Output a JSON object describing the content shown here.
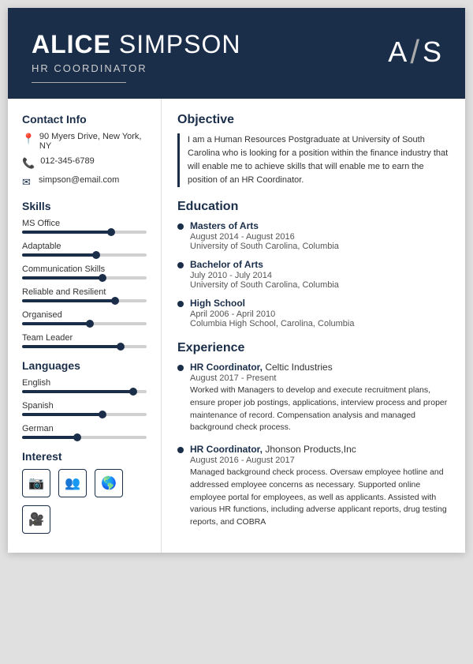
{
  "header": {
    "first_name": "ALICE",
    "last_name": "SIMPSON",
    "title": "HR COORDINATOR",
    "initial_first": "A",
    "slash": "/",
    "initial_last": "S"
  },
  "contact": {
    "section_title": "Contact Info",
    "address": "90 Myers Drive, New York, NY",
    "phone": "012-345-6789",
    "email": "simpson@email.com"
  },
  "skills": {
    "section_title": "Skills",
    "items": [
      {
        "name": "MS Office",
        "percent": 72
      },
      {
        "name": "Adaptable",
        "percent": 60
      },
      {
        "name": "Communication Skills",
        "percent": 65
      },
      {
        "name": "Reliable and Resilient",
        "percent": 75
      },
      {
        "name": "Organised",
        "percent": 55
      },
      {
        "name": "Team Leader",
        "percent": 80
      }
    ]
  },
  "languages": {
    "section_title": "Languages",
    "items": [
      {
        "name": "English",
        "percent": 90
      },
      {
        "name": "Spanish",
        "percent": 65
      },
      {
        "name": "German",
        "percent": 45
      }
    ]
  },
  "interest": {
    "section_title": "Interest",
    "icons": [
      "📷",
      "👥",
      "🌐",
      "🎬"
    ]
  },
  "objective": {
    "section_title": "Objective",
    "text": "I am a Human Resources Postgraduate at University of South Carolina who is looking for a position within the finance industry that will enable me to achieve skills that will enable me to earn the position of an HR Coordinator."
  },
  "education": {
    "section_title": "Education",
    "items": [
      {
        "degree": "Masters of Arts",
        "date": "August 2014 - August 2016",
        "school": "University of South Carolina, Columbia"
      },
      {
        "degree": "Bachelor of Arts",
        "date": "July 2010 - July 2014",
        "school": "University of South Carolina, Columbia"
      },
      {
        "degree": "High School",
        "date": "April 2006 - April 2010",
        "school": "Columbia High School, Carolina, Columbia"
      }
    ]
  },
  "experience": {
    "section_title": "Experience",
    "items": [
      {
        "title": "HR Coordinator",
        "company": "Celtic Industries",
        "date": "August 2017 - Present",
        "desc": "Worked with Managers to develop and execute recruitment plans, ensure proper job postings, applications, interview process and proper maintenance of record. Compensation analysis and managed background check process."
      },
      {
        "title": "HR Coordinator",
        "company": "Jhonson Products,Inc",
        "date": "August 2016 - August 2017",
        "desc": "Managed background check process. Oversaw employee hotline and addressed employee concerns as necessary. Supported online employee portal for employees, as well as applicants. Assisted with various HR functions, including adverse applicant reports, drug testing reports, and COBRA"
      }
    ]
  }
}
